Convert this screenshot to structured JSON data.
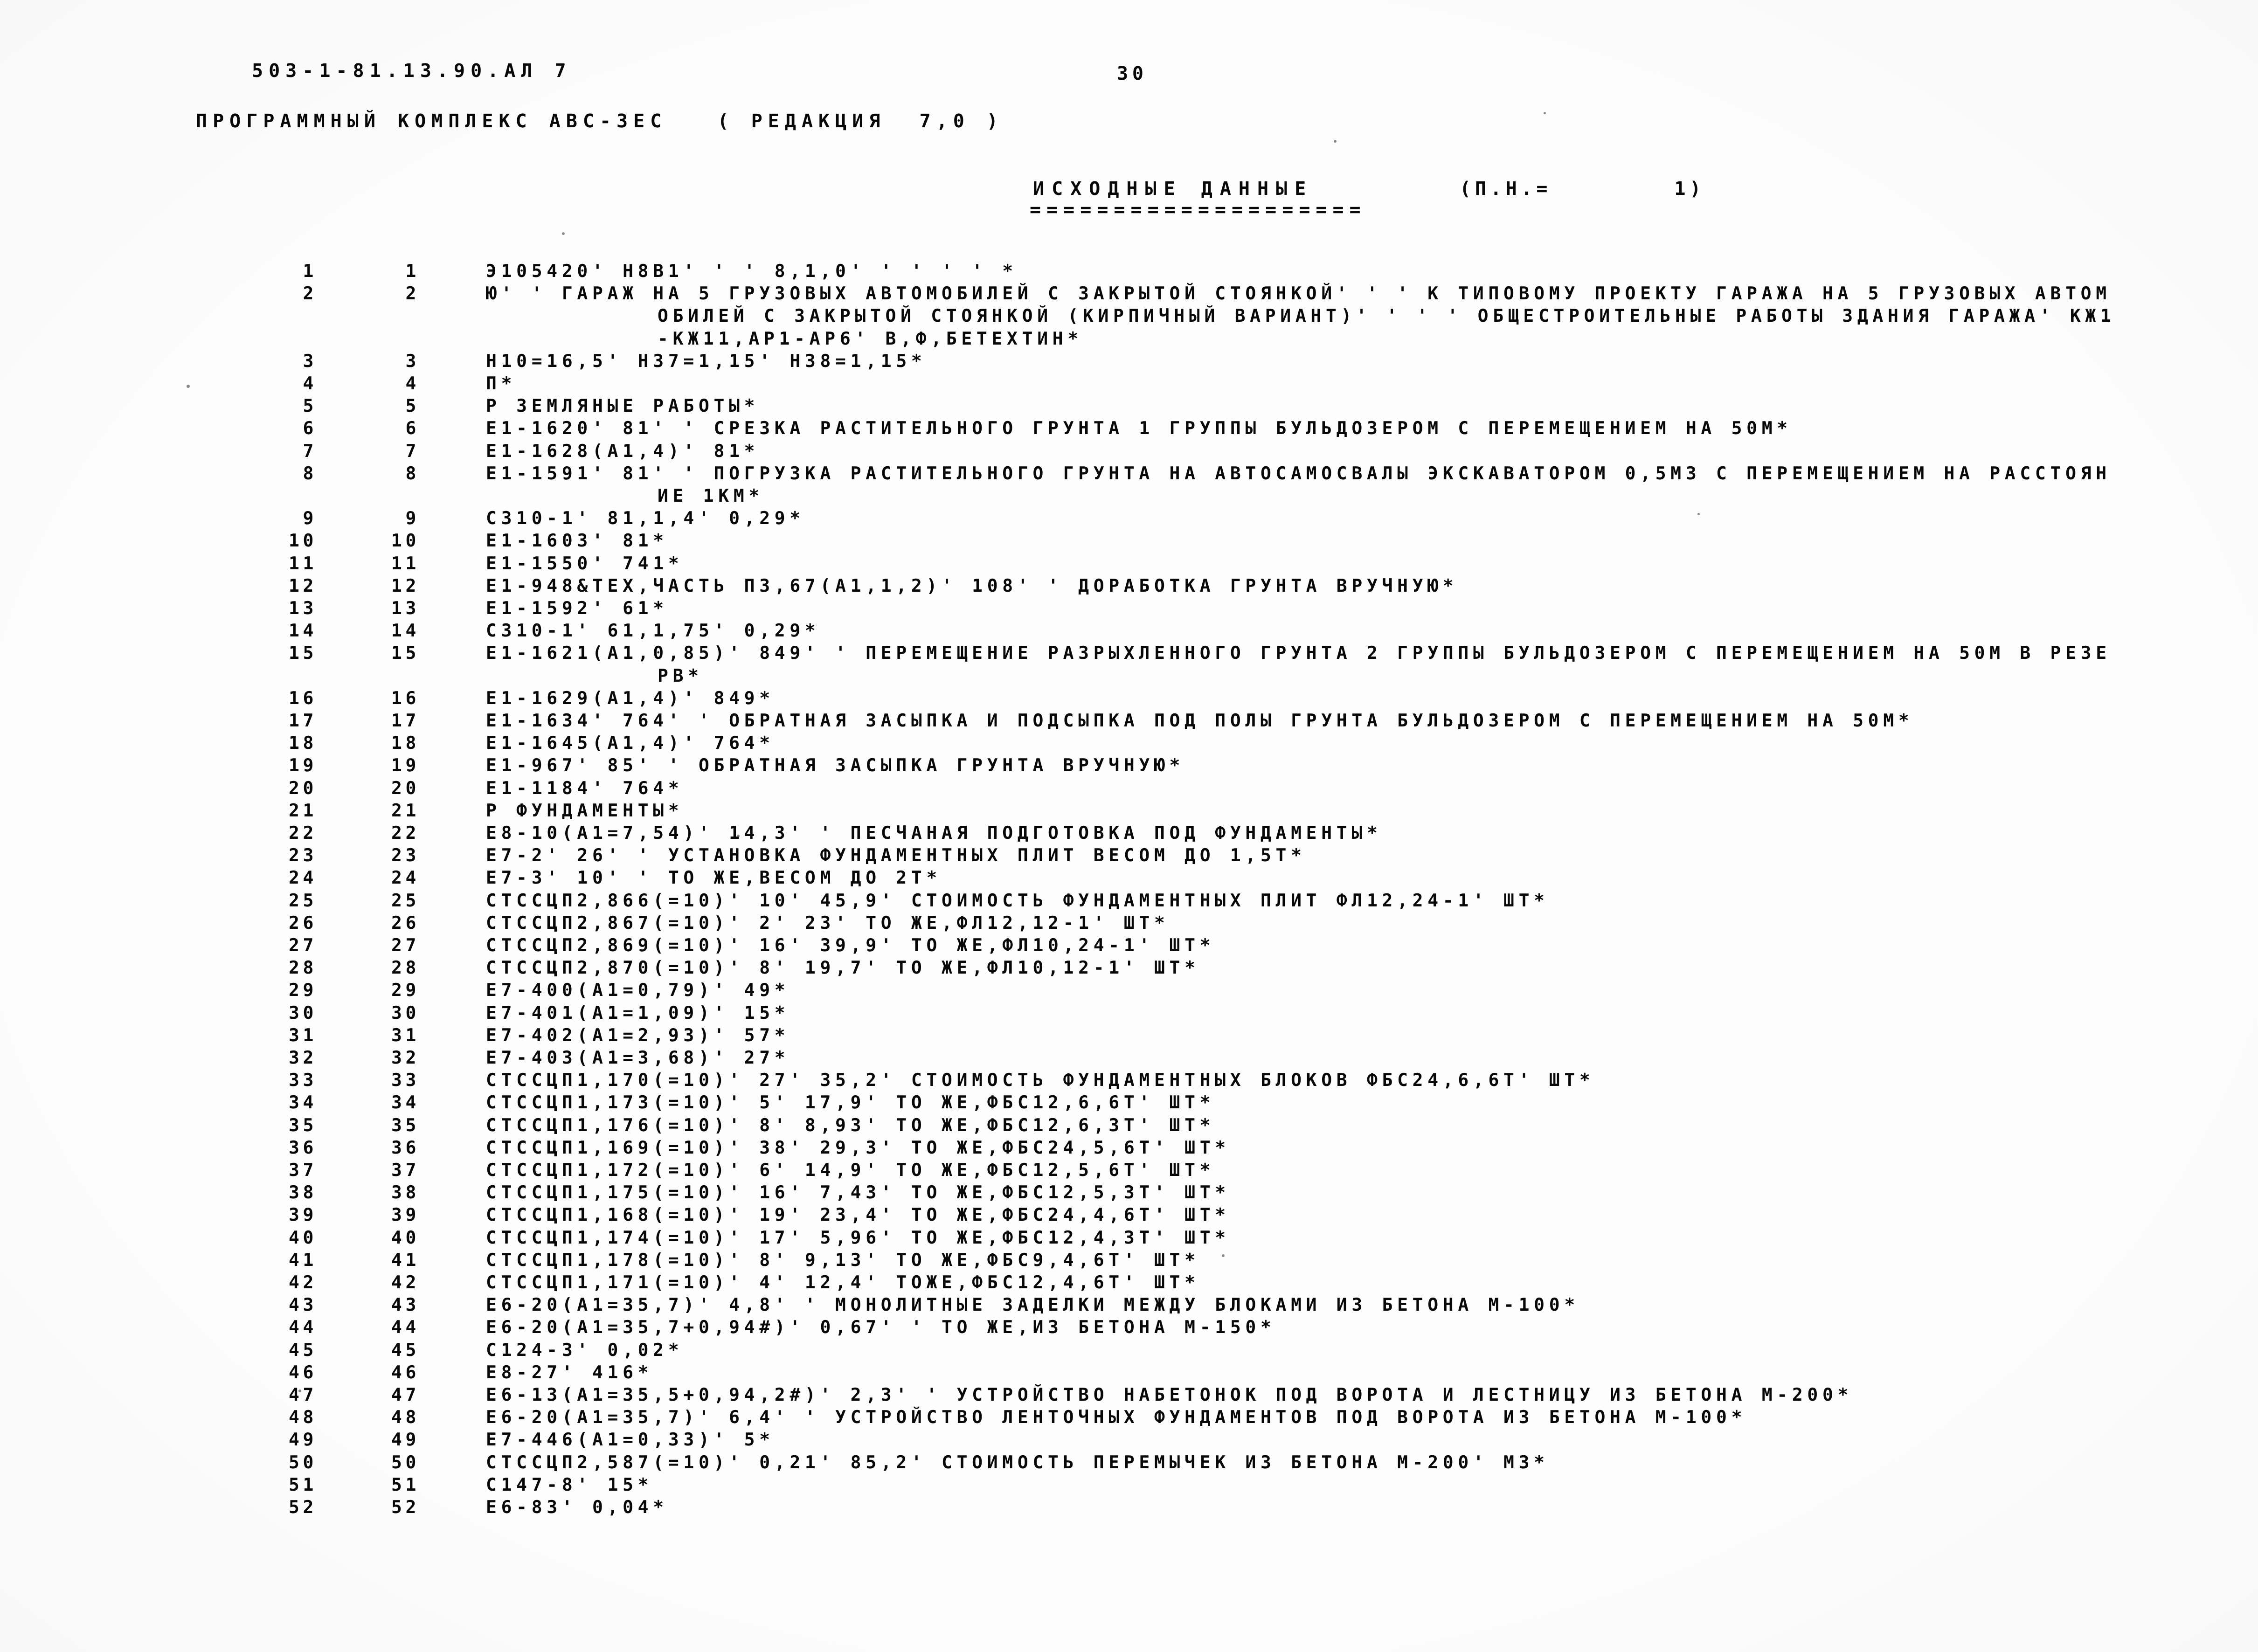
{
  "header": {
    "doc_code": "503-1-81.13.90.АЛ 7",
    "page_number": "30",
    "program_line": "ПРОГРАММНЫЙ КОМПЛЕКС АВС-ЗЕС   ( РЕДАКЦИЯ  7,0 )",
    "section_title": "ИСХОДНЫЕ ДАННЫЕ",
    "section_rule": "====================",
    "param_label": "(П.Н.=        1)"
  },
  "listing": {
    "rows": [
      {
        "a": "1",
        "b": "1",
        "text": "Э105420' Н8В1' ' ' 8,1,0' ' ' ' ' *",
        "cont": []
      },
      {
        "a": "2",
        "b": "2",
        "text": "Ю' ' ГАРАЖ НА 5 ГРУЗОВЫХ АВТОМОБИЛЕЙ С ЗАКРЫТОЙ СТОЯНКОЙ' ' ' К ТИПОВОМУ ПРОЕКТУ ГАРАЖА НА 5 ГРУЗОВЫХ АВТОМ",
        "cont": [
          "ОБИЛЕЙ С ЗАКРЫТОЙ СТОЯНКОЙ (КИРПИЧНЫЙ ВАРИАНТ)' ' ' ' ОБЩЕСТРОИТЕЛЬНЫЕ РАБОТЫ ЗДАНИЯ ГАРАЖА' КЖ1",
          "-КЖ11,АР1-АР6' В,Ф,БЕТЕХТИН*"
        ]
      },
      {
        "a": "3",
        "b": "3",
        "text": "Н10=16,5' Н37=1,15' Н38=1,15*",
        "cont": []
      },
      {
        "a": "4",
        "b": "4",
        "text": "П*",
        "cont": []
      },
      {
        "a": "5",
        "b": "5",
        "text": "Р ЗЕМЛЯНЫЕ РАБОТЫ*",
        "cont": []
      },
      {
        "a": "6",
        "b": "6",
        "text": "Е1-1620' 81' ' СРЕЗКА РАСТИТЕЛЬНОГО ГРУНТА 1 ГРУППЫ БУЛЬДОЗЕРОМ С ПЕРЕМЕЩЕНИЕМ НА 50М*",
        "cont": []
      },
      {
        "a": "7",
        "b": "7",
        "text": "Е1-1628(А1,4)' 81*",
        "cont": []
      },
      {
        "a": "8",
        "b": "8",
        "text": "Е1-1591' 81' ' ПОГРУЗКА РАСТИТЕЛЬНОГО ГРУНТА НА АВТОСАМОСВАЛЫ ЭКСКАВАТОРОМ 0,5М3 С ПЕРЕМЕЩЕНИЕМ НА РАССТОЯН",
        "cont": [
          "ИЕ 1КМ*"
        ]
      },
      {
        "a": "9",
        "b": "9",
        "text": "С310-1' 81,1,4' 0,29*",
        "cont": []
      },
      {
        "a": "10",
        "b": "10",
        "text": "Е1-1603' 81*",
        "cont": []
      },
      {
        "a": "11",
        "b": "11",
        "text": "Е1-1550' 741*",
        "cont": []
      },
      {
        "a": "12",
        "b": "12",
        "text": "Е1-948&ТЕХ,ЧАСТЬ П3,67(А1,1,2)' 108' ' ДОРАБОТКА ГРУНТА ВРУЧНУЮ*",
        "cont": []
      },
      {
        "a": "13",
        "b": "13",
        "text": "Е1-1592' 61*",
        "cont": []
      },
      {
        "a": "14",
        "b": "14",
        "text": "С310-1' 61,1,75' 0,29*",
        "cont": []
      },
      {
        "a": "15",
        "b": "15",
        "text": "Е1-1621(А1,0,85)' 849' ' ПЕРЕМЕЩЕНИЕ РАЗРЫХЛЕННОГО ГРУНТА 2 ГРУППЫ БУЛЬДОЗЕРОМ С ПЕРЕМЕЩЕНИЕМ НА 50М В РЕЗЕ",
        "cont": [
          "РВ*"
        ]
      },
      {
        "a": "16",
        "b": "16",
        "text": "Е1-1629(А1,4)' 849*",
        "cont": []
      },
      {
        "a": "17",
        "b": "17",
        "text": "Е1-1634' 764' ' ОБРАТНАЯ ЗАСЫПКА И ПОДСЫПКА ПОД ПОЛЫ ГРУНТА БУЛЬДОЗЕРОМ С ПЕРЕМЕЩЕНИЕМ НА 50М*",
        "cont": []
      },
      {
        "a": "18",
        "b": "18",
        "text": "Е1-1645(А1,4)' 764*",
        "cont": []
      },
      {
        "a": "19",
        "b": "19",
        "text": "Е1-967' 85' ' ОБРАТНАЯ ЗАСЫПКА ГРУНТА ВРУЧНУЮ*",
        "cont": []
      },
      {
        "a": "20",
        "b": "20",
        "text": "Е1-1184' 764*",
        "cont": []
      },
      {
        "a": "21",
        "b": "21",
        "text": "Р ФУНДАМЕНТЫ*",
        "cont": []
      },
      {
        "a": "22",
        "b": "22",
        "text": "Е8-10(А1=7,54)' 14,3' ' ПЕСЧАНАЯ ПОДГОТОВКА ПОД ФУНДАМЕНТЫ*",
        "cont": []
      },
      {
        "a": "23",
        "b": "23",
        "text": "Е7-2' 26' ' УСТАНОВКА ФУНДАМЕНТНЫХ ПЛИТ ВЕСОМ ДО 1,5Т*",
        "cont": []
      },
      {
        "a": "24",
        "b": "24",
        "text": "Е7-3' 10' ' ТО ЖЕ,ВЕСОМ ДО 2Т*",
        "cont": []
      },
      {
        "a": "25",
        "b": "25",
        "text": "СТССЦП2,866(=10)' 10' 45,9' СТОИМОСТЬ ФУНДАМЕНТНЫХ ПЛИТ ФЛ12,24-1' ШТ*",
        "cont": []
      },
      {
        "a": "26",
        "b": "26",
        "text": "СТССЦП2,867(=10)' 2' 23' ТО ЖЕ,ФЛ12,12-1' ШТ*",
        "cont": []
      },
      {
        "a": "27",
        "b": "27",
        "text": "СТССЦП2,869(=10)' 16' 39,9' ТО ЖЕ,ФЛ10,24-1' ШТ*",
        "cont": []
      },
      {
        "a": "28",
        "b": "28",
        "text": "СТССЦП2,870(=10)' 8' 19,7' ТО ЖЕ,ФЛ10,12-1' ШТ*",
        "cont": []
      },
      {
        "a": "29",
        "b": "29",
        "text": "Е7-400(А1=0,79)' 49*",
        "cont": []
      },
      {
        "a": "30",
        "b": "30",
        "text": "Е7-401(А1=1,09)' 15*",
        "cont": []
      },
      {
        "a": "31",
        "b": "31",
        "text": "Е7-402(А1=2,93)' 57*",
        "cont": []
      },
      {
        "a": "32",
        "b": "32",
        "text": "Е7-403(А1=3,68)' 27*",
        "cont": []
      },
      {
        "a": "33",
        "b": "33",
        "text": "СТССЦП1,170(=10)' 27' 35,2' СТОИМОСТЬ ФУНДАМЕНТНЫХ БЛОКОВ ФБС24,6,6Т' ШТ*",
        "cont": []
      },
      {
        "a": "34",
        "b": "34",
        "text": "СТССЦП1,173(=10)' 5' 17,9' ТО ЖЕ,ФБС12,6,6Т' ШТ*",
        "cont": []
      },
      {
        "a": "35",
        "b": "35",
        "text": "СТССЦП1,176(=10)' 8' 8,93' ТО ЖЕ,ФБС12,6,3Т' ШТ*",
        "cont": []
      },
      {
        "a": "36",
        "b": "36",
        "text": "СТССЦП1,169(=10)' 38' 29,3' ТО ЖЕ,ФБС24,5,6Т' ШТ*",
        "cont": []
      },
      {
        "a": "37",
        "b": "37",
        "text": "СТССЦП1,172(=10)' 6' 14,9' ТО ЖЕ,ФБС12,5,6Т' ШТ*",
        "cont": []
      },
      {
        "a": "38",
        "b": "38",
        "text": "СТССЦП1,175(=10)' 16' 7,43' ТО ЖЕ,ФБС12,5,3Т' ШТ*",
        "cont": []
      },
      {
        "a": "39",
        "b": "39",
        "text": "СТССЦП1,168(=10)' 19' 23,4' ТО ЖЕ,ФБС24,4,6Т' ШТ*",
        "cont": []
      },
      {
        "a": "40",
        "b": "40",
        "text": "СТССЦП1,174(=10)' 17' 5,96' ТО ЖЕ,ФБС12,4,3Т' ШТ*",
        "cont": []
      },
      {
        "a": "41",
        "b": "41",
        "text": "СТССЦП1,178(=10)' 8' 9,13' ТО ЖЕ,ФБС9,4,6Т' ШТ*",
        "cont": []
      },
      {
        "a": "42",
        "b": "42",
        "text": "СТССЦП1,171(=10)' 4' 12,4' ТОЖЕ,ФБС12,4,6Т' ШТ*",
        "cont": []
      },
      {
        "a": "43",
        "b": "43",
        "text": "Е6-20(А1=35,7)' 4,8' ' МОНОЛИТНЫЕ ЗАДЕЛКИ МЕЖДУ БЛОКАМИ ИЗ БЕТОНА М-100*",
        "cont": []
      },
      {
        "a": "44",
        "b": "44",
        "text": "Е6-20(А1=35,7+0,94#)' 0,67' ' ТО ЖЕ,ИЗ БЕТОНА М-150*",
        "cont": []
      },
      {
        "a": "45",
        "b": "45",
        "text": "С124-3' 0,02*",
        "cont": []
      },
      {
        "a": "46",
        "b": "46",
        "text": "Е8-27' 416*",
        "cont": []
      },
      {
        "a": "47",
        "b": "47",
        "text": "Е6-13(А1=35,5+0,94,2#)' 2,3' ' УСТРОЙСТВО НАБЕТОНОК ПОД ВОРОТА И ЛЕСТНИЦУ ИЗ БЕТОНА М-200*",
        "cont": []
      },
      {
        "a": "48",
        "b": "48",
        "text": "Е6-20(А1=35,7)' 6,4' ' УСТРОЙСТВО ЛЕНТОЧНЫХ ФУНДАМЕНТОВ ПОД ВОРОТА ИЗ БЕТОНА М-100*",
        "cont": []
      },
      {
        "a": "49",
        "b": "49",
        "text": "Е7-446(А1=0,33)' 5*",
        "cont": []
      },
      {
        "a": "50",
        "b": "50",
        "text": "СТССЦП2,587(=10)' 0,21' 85,2' СТОИМОСТЬ ПЕРЕМЫЧЕК ИЗ БЕТОНА М-200' М3*",
        "cont": []
      },
      {
        "a": "51",
        "b": "51",
        "text": "С147-8' 15*",
        "cont": []
      },
      {
        "a": "52",
        "b": "52",
        "text": "Е6-83' 0,04*",
        "cont": []
      }
    ]
  }
}
